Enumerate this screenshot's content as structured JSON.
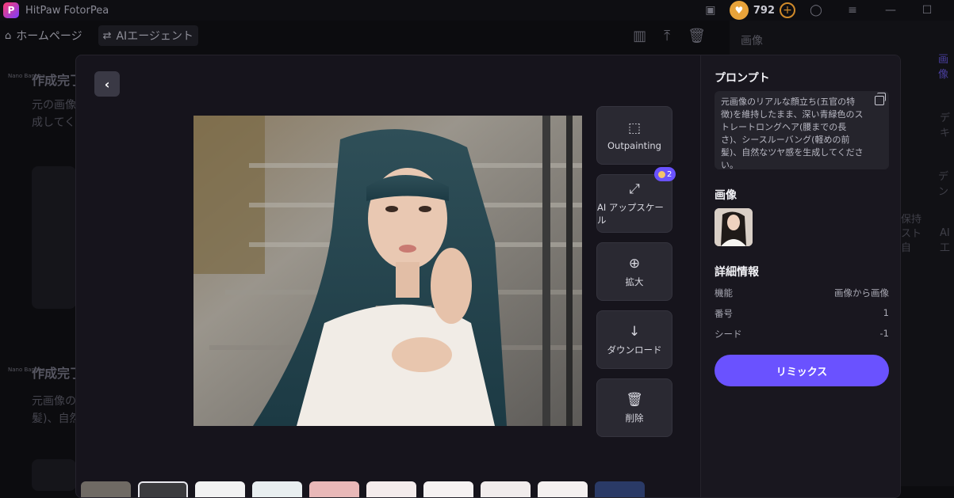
{
  "titlebar": {
    "app_title": "HitPaw FotorPea",
    "credits": "792"
  },
  "nav": {
    "home": "ホームページ",
    "agent": "AIエージェント"
  },
  "background": {
    "item1_title": "作成完了",
    "item1_text_l1": "元の画像",
    "item1_text_l2": "成してくだ",
    "item2_title": "作成完了",
    "item2_text_l1": "元画像の",
    "item2_text_l2": "髪)、自然",
    "badge": "Nano Banana",
    "right_title": "画像",
    "right_texts": [
      "画像",
      "デキ",
      "デン",
      "保持",
      "スト",
      "自",
      "AI工"
    ]
  },
  "modal": {
    "tools": [
      {
        "label": "Outpainting",
        "icon": "outpainting-icon"
      },
      {
        "label": "AI アップスケール",
        "icon": "upscale-icon"
      },
      {
        "label": "拡大",
        "icon": "zoom-in-icon"
      },
      {
        "label": "ダウンロード",
        "icon": "download-icon"
      },
      {
        "label": "削除",
        "icon": "trash-icon"
      }
    ],
    "upscale_cost": "2"
  },
  "side": {
    "prompt_title": "プロンプト",
    "prompt_text": "元画像のリアルな顔立ち(五官の特徴)を維持したまま、深い青緑色のストレートロングヘア(腰までの長さ)、シースルーバング(軽めの前髪)、自然なツヤ感を生成してください。",
    "image_title": "画像",
    "details_title": "詳細情報",
    "details": [
      {
        "label": "機能",
        "value": "画像から画像"
      },
      {
        "label": "番号",
        "value": "1"
      },
      {
        "label": "シード",
        "value": "-1"
      }
    ],
    "remix_label": "リミックス"
  },
  "colors": {
    "accent": "#6a52ff",
    "coin": "#e8a33a",
    "bg": "#16141c"
  }
}
